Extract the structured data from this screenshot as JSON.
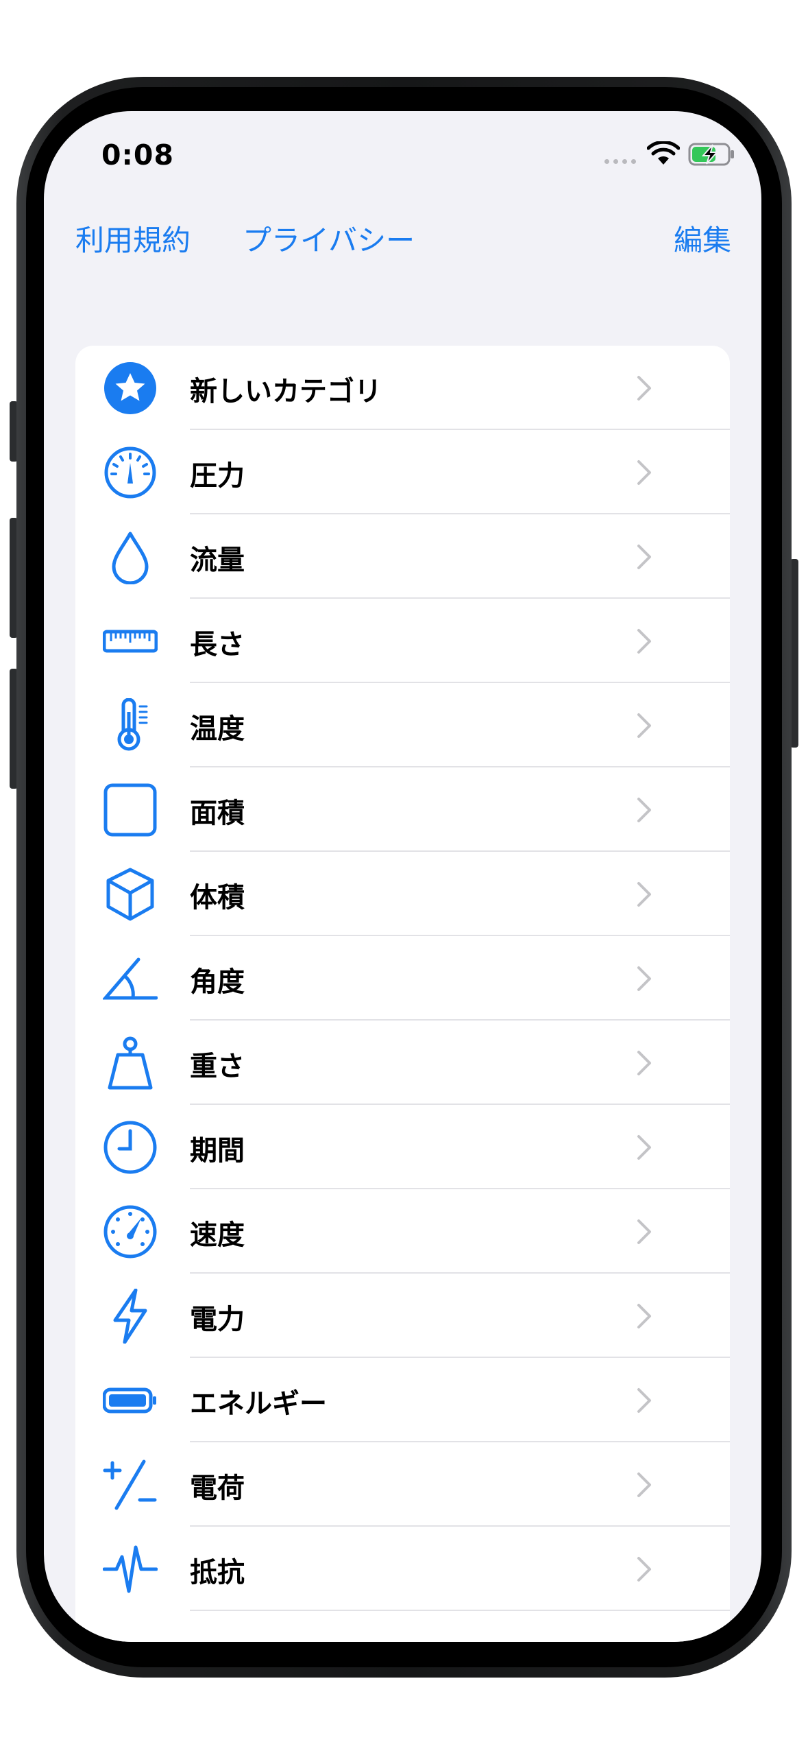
{
  "status_bar": {
    "time": "0:08"
  },
  "nav": {
    "terms": "利用規約",
    "privacy": "プライバシー",
    "edit": "編集"
  },
  "categories": [
    {
      "label": "新しいカテゴリ",
      "icon": "star-circle-icon"
    },
    {
      "label": "圧力",
      "icon": "gauge-icon"
    },
    {
      "label": "流量",
      "icon": "drop-icon"
    },
    {
      "label": "長さ",
      "icon": "ruler-icon"
    },
    {
      "label": "温度",
      "icon": "thermometer-icon"
    },
    {
      "label": "面積",
      "icon": "square-icon"
    },
    {
      "label": "体積",
      "icon": "cube-icon"
    },
    {
      "label": "角度",
      "icon": "angle-icon"
    },
    {
      "label": "重さ",
      "icon": "scale-weight-icon"
    },
    {
      "label": "期間",
      "icon": "clock-icon"
    },
    {
      "label": "速度",
      "icon": "speedometer-icon"
    },
    {
      "label": "電力",
      "icon": "bolt-icon"
    },
    {
      "label": "エネルギー",
      "icon": "battery-icon"
    },
    {
      "label": "電荷",
      "icon": "plus-minus-icon"
    },
    {
      "label": "抵抗",
      "icon": "waveform-icon"
    }
  ],
  "colors": {
    "accent": "#1a7cf0",
    "background": "#f2f2f7",
    "chevron": "#c4c4c7"
  }
}
